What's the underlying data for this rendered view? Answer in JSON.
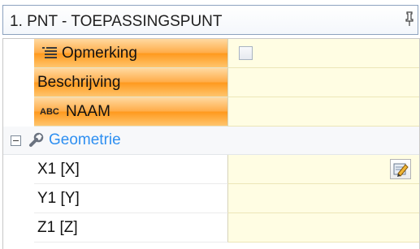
{
  "panel": {
    "title": "1. PNT - TOEPASSINGSPUNT",
    "pin_icon": "pin-icon"
  },
  "properties": {
    "opmerking": {
      "label": "Opmerking",
      "icon": "comment-lines-icon",
      "value": "",
      "checked": false
    },
    "beschrijving": {
      "label": "Beschrijving",
      "value": ""
    },
    "naam": {
      "label": "NAAM",
      "icon_text": "ABC",
      "value": ""
    }
  },
  "group": {
    "label": "Geometrie",
    "expanded": true,
    "icon": "wrench-icon"
  },
  "geometry": {
    "x1": {
      "label": "X1 [X]",
      "value": "",
      "edit_icon": "edit-pencil-icon"
    },
    "y1": {
      "label": "Y1 [Y]",
      "value": ""
    },
    "z1": {
      "label": "Z1 [Z]",
      "value": ""
    }
  },
  "colors": {
    "highlight_orange": "#ffad4a",
    "value_background": "#fffde3",
    "group_text": "#2e8ff1"
  }
}
